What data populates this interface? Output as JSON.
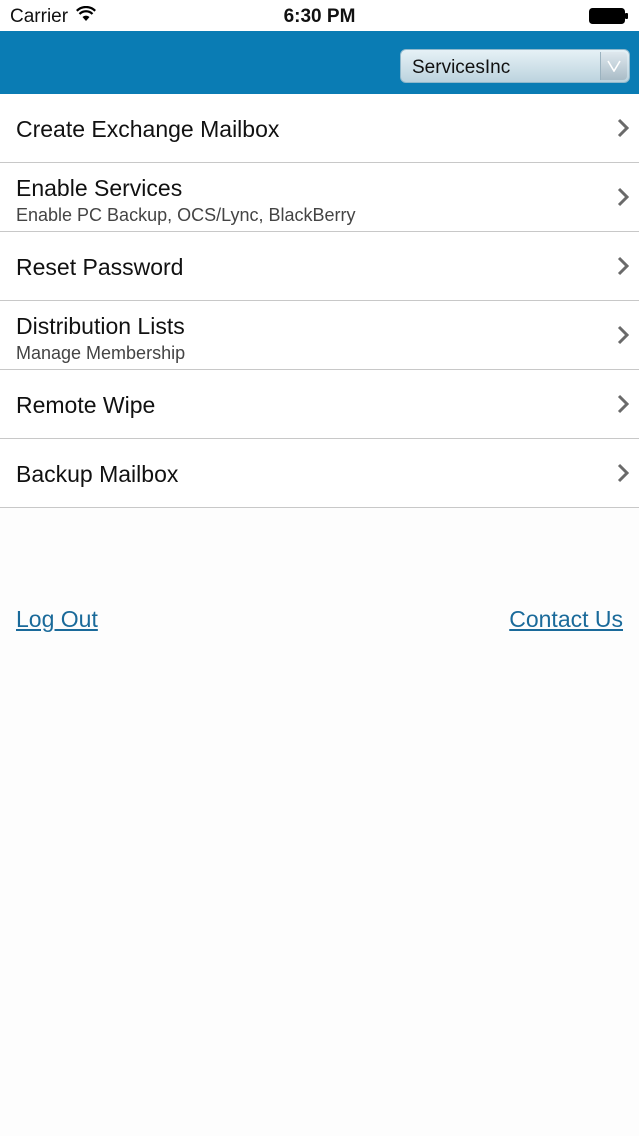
{
  "status_bar": {
    "carrier": "Carrier",
    "time": "6:30 PM",
    "wifi_icon": "wifi-icon",
    "battery_icon": "battery-icon"
  },
  "header": {
    "organization_select": {
      "selected": "ServicesInc",
      "icon": "chevron-down-icon"
    },
    "color": "#0a7cb4"
  },
  "menu": {
    "items": [
      {
        "title": "Create Exchange Mailbox",
        "subtitle": ""
      },
      {
        "title": "Enable Services",
        "subtitle": "Enable PC Backup, OCS/Lync, BlackBerry"
      },
      {
        "title": "Reset Password",
        "subtitle": ""
      },
      {
        "title": "Distribution Lists",
        "subtitle": "Manage Membership"
      },
      {
        "title": "Remote Wipe",
        "subtitle": ""
      },
      {
        "title": "Backup Mailbox",
        "subtitle": ""
      }
    ],
    "chevron_icon": "chevron-right-icon"
  },
  "footer": {
    "log_out": "Log Out",
    "contact_us": "Contact Us",
    "link_color": "#1a6a9a"
  }
}
